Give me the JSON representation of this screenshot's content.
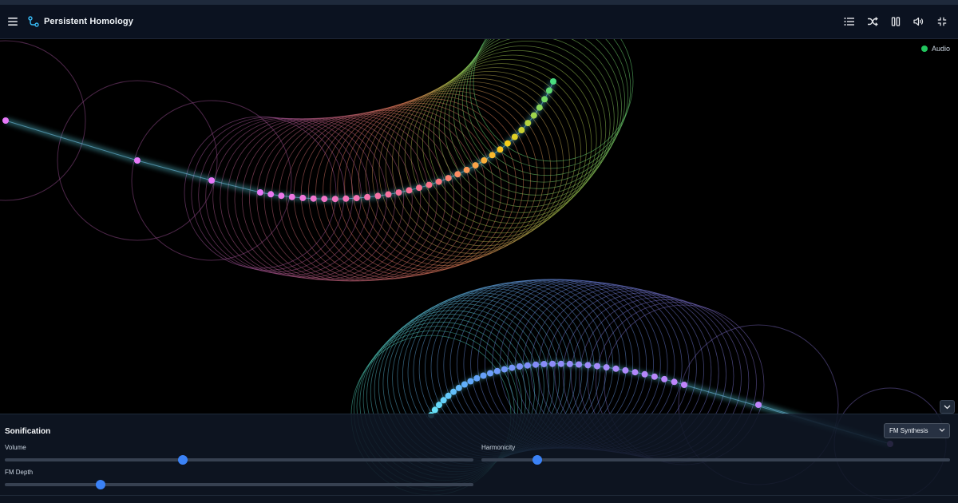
{
  "header": {
    "menu_icon": "menu-icon",
    "logo_icon": "graph-nodes-icon",
    "title": "Persistent Homology",
    "actions": [
      {
        "name": "list-button",
        "icon": "list-icon"
      },
      {
        "name": "shuffle-button",
        "icon": "shuffle-icon"
      },
      {
        "name": "pause-button",
        "icon": "pause-icon"
      },
      {
        "name": "volume-button",
        "icon": "speaker-icon"
      },
      {
        "name": "exit-fullscreen-button",
        "icon": "minimize-icon"
      }
    ]
  },
  "audio_indicator": {
    "label": "Audio",
    "color": "#22c55e"
  },
  "panel": {
    "title": "Sonification",
    "mode": {
      "selected": "FM Synthesis"
    },
    "sliders": {
      "volume": {
        "label": "Volume",
        "value": 0.38
      },
      "harmonicity": {
        "label": "Harmonicity",
        "value": 0.12
      },
      "fm_depth": {
        "label": "FM Depth",
        "value": 0.205
      }
    }
  },
  "colors": {
    "accent": "#3b82f6",
    "header_bg": "#0b1220",
    "panel_bg": "#0f1724",
    "audio_on": "#22c55e"
  }
}
